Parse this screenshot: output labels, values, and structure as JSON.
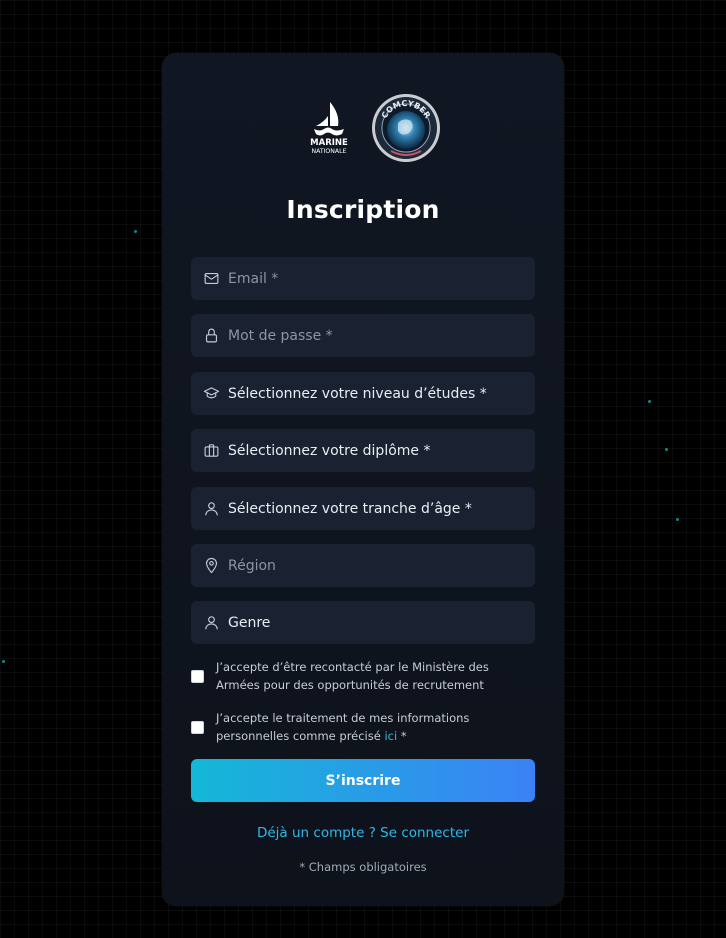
{
  "logos": {
    "marine_line1": "MARINE",
    "marine_line2": "NATIONALE",
    "comcyber": "COMCYBER"
  },
  "title": "Inscription",
  "fields": [
    {
      "name": "email",
      "icon": "mail-icon",
      "placeholder": "Email *"
    },
    {
      "name": "password",
      "icon": "lock-icon",
      "placeholder": "Mot de passe *"
    },
    {
      "name": "education",
      "icon": "graduation-cap-icon",
      "value": "Sélectionnez votre niveau d’études *"
    },
    {
      "name": "diploma",
      "icon": "briefcase-icon",
      "value": "Sélectionnez votre diplôme *"
    },
    {
      "name": "age",
      "icon": "user-icon",
      "value": "Sélectionnez votre tranche d’âge *"
    },
    {
      "name": "region",
      "icon": "map-pin-icon",
      "placeholder": "Région"
    },
    {
      "name": "gender",
      "icon": "user-icon",
      "value": "Genre"
    }
  ],
  "checkboxes": {
    "contact": "J’accepte d’être recontacté par le Ministère des Armées pour des opportunités de recrutement",
    "privacy_text": "J’accepte le traitement de mes informations personnelles comme précisé",
    "privacy_link": "ici",
    "privacy_required": "*"
  },
  "submit_label": "S’inscrire",
  "login_link": "Déjà un compte ? Se connecter",
  "required_note": "* Champs obligatoires",
  "colors": {
    "accent_start": "#14b8d6",
    "accent_end": "#3b82f6",
    "link": "#2fb8e6",
    "card_bg": "#111722",
    "field_bg": "#1a2130"
  }
}
